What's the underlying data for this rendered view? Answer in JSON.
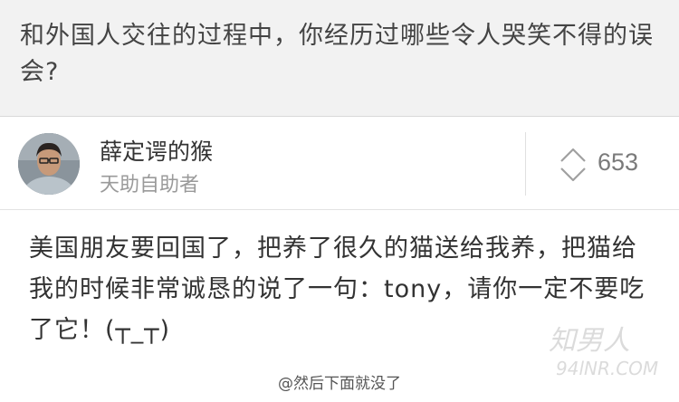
{
  "question": {
    "title": "和外国人交往的过程中，你经历过哪些令人哭笑不得的误会?"
  },
  "author": {
    "name": "薛定谔的猴",
    "bio": "天助自助者"
  },
  "votes": {
    "count": "653",
    "icon": "vote-arrows-icon"
  },
  "answer": {
    "text": "美国朋友要回国了，把养了很久的猫送给我养，把猫给我的时候非常诚恳的说了一句：tony，请你一定不要吃了它！(┬_┬)"
  },
  "watermark": {
    "caption": "@然后下面就没了",
    "brand_text": "知男人 94lNR.COM"
  }
}
